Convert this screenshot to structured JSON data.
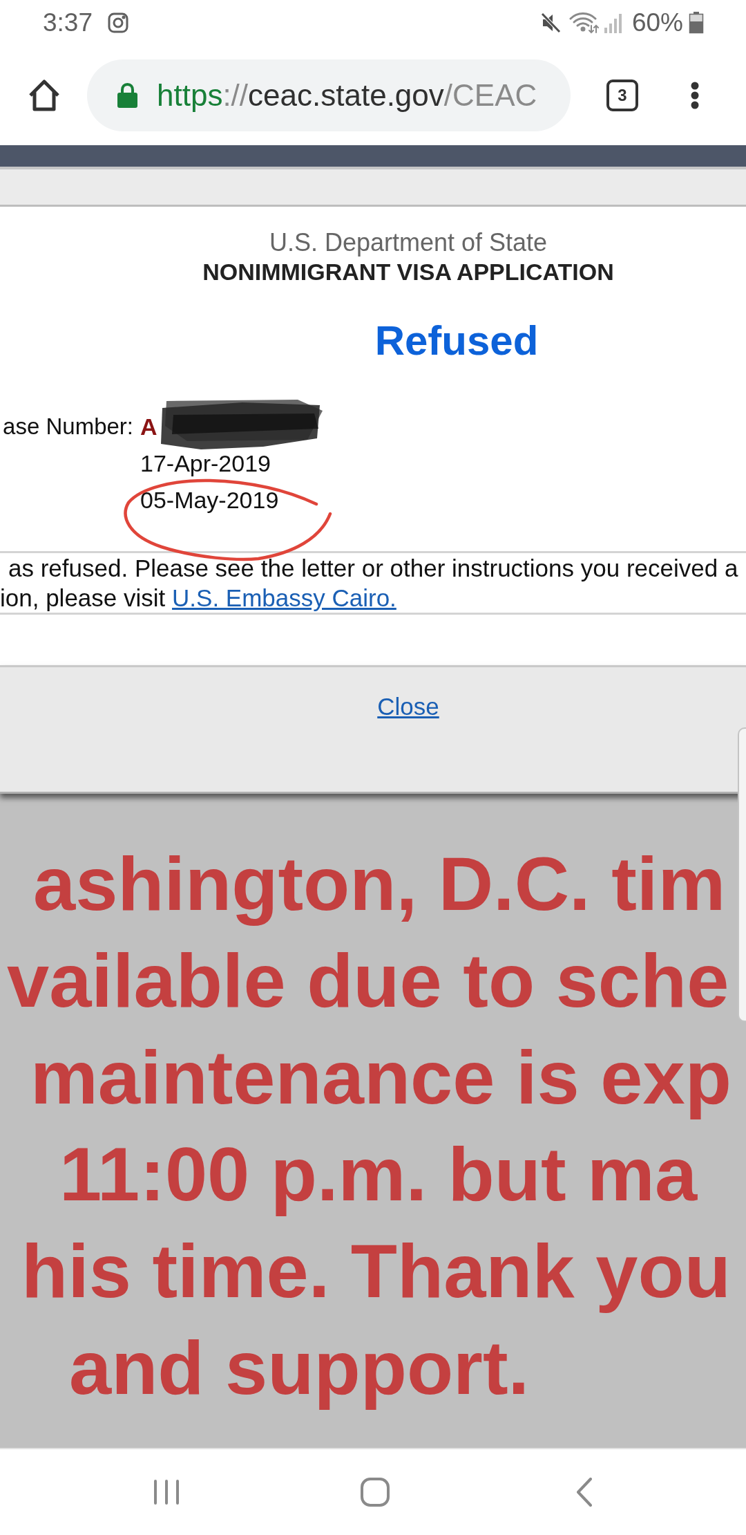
{
  "status_bar": {
    "time": "3:37",
    "battery": "60%"
  },
  "browser": {
    "url_parts": [
      {
        "text": "https",
        "kind": "scheme"
      },
      {
        "text": "://",
        "kind": "separator"
      },
      {
        "text": "ceac.state.gov",
        "kind": "host"
      },
      {
        "text": "/CEAC",
        "kind": "path"
      }
    ],
    "tab_count": "3"
  },
  "dialog": {
    "agency": "U.S. Department of State",
    "title": "NONIMMIGRANT VISA APPLICATION",
    "status": "Refused",
    "fields": [
      {
        "label": "ase Number:",
        "value": "A",
        "kind": "redacted"
      },
      {
        "value": "17-Apr-2019",
        "kind": "plain"
      },
      {
        "value": "05-May-2019",
        "kind": "circled"
      }
    ],
    "message_lines": [
      "as refused. Please see the letter or other instructions you received a",
      "ion, please visit"
    ],
    "message_link": "U.S. Embassy Cairo.",
    "close_link": "Close"
  },
  "banner_lines": [
    "ashington, D.C. tim",
    "vailable due to sche",
    "maintenance is exp",
    "11:00 p.m. but ma",
    "his time. Thank you",
    "and support."
  ]
}
